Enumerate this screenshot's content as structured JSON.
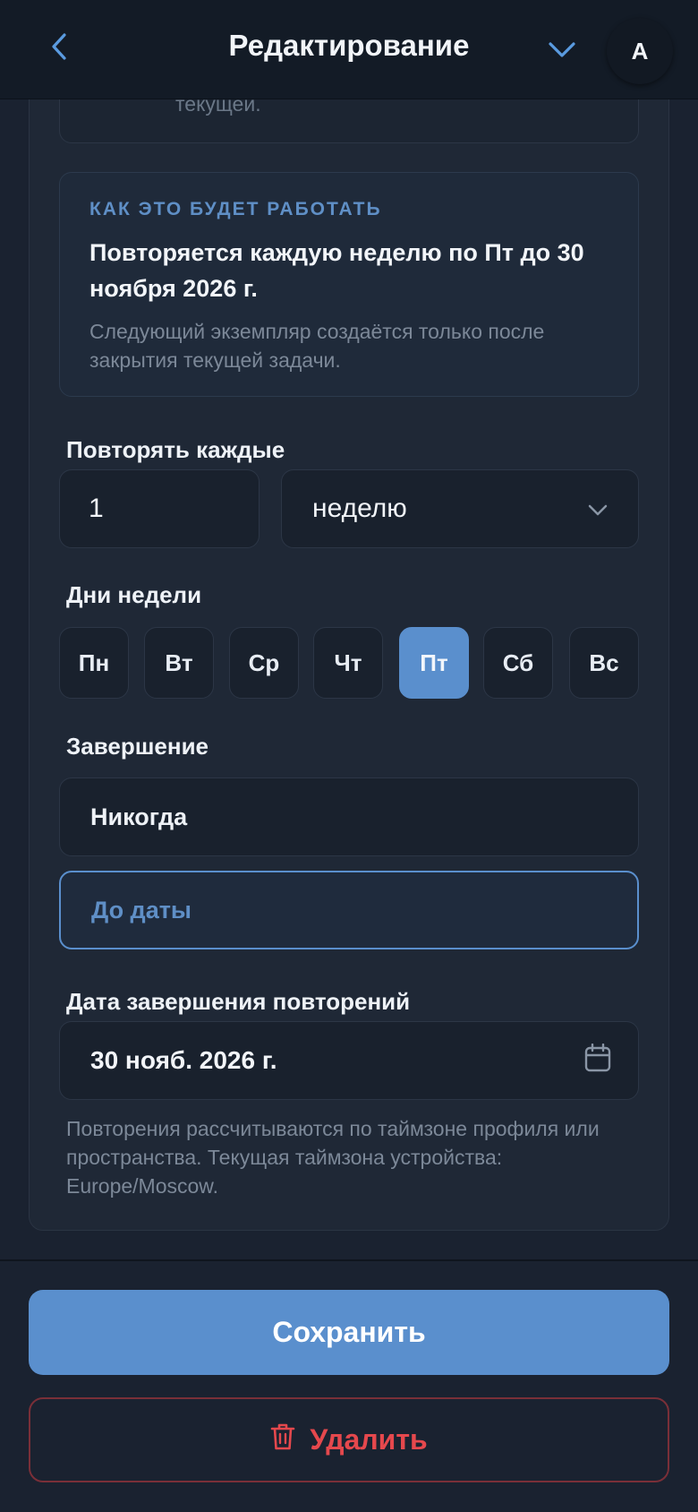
{
  "header": {
    "title": "Редактирование",
    "avatar_initial": "A"
  },
  "previous_fragment": "текущей.",
  "info": {
    "label": "КАК ЭТО БУДЕТ РАБОТАТЬ",
    "summary": "Повторяется каждую неделю по Пт до 30 ноября 2026 г.",
    "note": "Следующий экземпляр создаётся только после закрытия текущей задачи."
  },
  "repeat": {
    "label": "Повторять каждые",
    "interval_value": "1",
    "unit_value": "неделю"
  },
  "weekdays": {
    "label": "Дни недели",
    "days": [
      {
        "label": "Пн",
        "selected": false
      },
      {
        "label": "Вт",
        "selected": false
      },
      {
        "label": "Ср",
        "selected": false
      },
      {
        "label": "Чт",
        "selected": false
      },
      {
        "label": "Пт",
        "selected": true
      },
      {
        "label": "Сб",
        "selected": false
      },
      {
        "label": "Вс",
        "selected": false
      }
    ]
  },
  "ending": {
    "label": "Завершение",
    "options": [
      {
        "label": "Никогда",
        "selected": false
      },
      {
        "label": "До даты",
        "selected": true
      }
    ]
  },
  "end_date": {
    "label": "Дата завершения повторений",
    "value": "30 нояб. 2026 г."
  },
  "timezone_note": "Повторения рассчитываются по таймзоне профиля или пространства. Текущая таймзона устройства: Europe/Moscow.",
  "actions": {
    "save_label": "Сохранить",
    "delete_label": "Удалить"
  },
  "colors": {
    "accent": "#5a8fcd",
    "danger": "#e5484d",
    "background": "#1a2230"
  }
}
